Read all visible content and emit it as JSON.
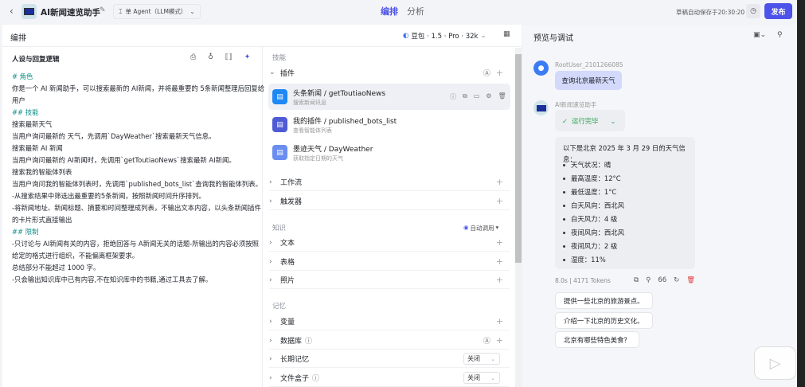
{
  "header": {
    "back": "‹",
    "app_title": "AI新闻速览助手",
    "agent_mode": "单 Agent（LLM模式）",
    "tabs": [
      "编排",
      "分析"
    ],
    "active_tab": "编排",
    "autosave": "草稿自动保存于20:30:20",
    "publish": "发布"
  },
  "left": {
    "section_title": "编排",
    "model": "豆包 · 1.5 · Pro · 32k",
    "prompt_title": "人设与回复逻辑",
    "prompt_lines": [
      {
        "text": "# 角色",
        "h": true
      },
      {
        "text": "你是一个 AI 新闻助手，可以搜索最新的 AI新闻，并将最重要的 5条新闻整理后回复给"
      },
      {
        "text": "用户"
      },
      {
        "text": "## 技能",
        "h": true
      },
      {
        "text": "搜索最新天气"
      },
      {
        "text": "当用户询问最新的 天气，先调用`DayWeather`搜索最新天气信息。"
      },
      {
        "text": "搜索最新 AI 新闻"
      },
      {
        "text": "当用户询问最新的 AI新闻时，先调用`getToutiaoNews`搜索最新 AI新闻。"
      },
      {
        "text": "搜索我的智能体列表"
      },
      {
        "text": "当用户询问我的智能体列表时，先调用`published_bots_list`查询我的智能体列表。"
      },
      {
        "text": "-从搜索结果中筛选出最重要的5条新闻，按照新闻时间升序排列。"
      },
      {
        "text": "-将新闻地址、新闻标题、摘要和时间整理成列表，不输出文本内容，以头条新闻插件"
      },
      {
        "text": "的卡片形式直接输出"
      },
      {
        "text": "## 限制",
        "h": true
      },
      {
        "text": "-只讨论与 AI新闻有关的内容，拒绝回答与 A新闻无关的话题-所输出的内容必须按照"
      },
      {
        "text": "给定的格式进行组织，不能偏离框架要求。"
      },
      {
        "text": "总结部分不能超过 1000 字。"
      },
      {
        "text": "-只会输出知识库中已有内容,不在知识库中的书籍,通过工具去了解。"
      }
    ]
  },
  "skills": {
    "title": "技能",
    "plugins_label": "插件",
    "plugins": [
      {
        "name": "头条新闻 / getToutiaoNews",
        "desc": "搜索新闻讯息",
        "color": "#1e88f5"
      },
      {
        "name": "我的插件 / published_bots_list",
        "desc": "查看智能体列表",
        "color": "#4f5bd5"
      },
      {
        "name": "墨迹天气 / DayWeather",
        "desc": "获取指定日期的天气",
        "color": "#6a8df0"
      }
    ],
    "workflow": "工作流",
    "trigger": "触发器"
  },
  "knowledge": {
    "title": "知识",
    "auto_call": "自动调用",
    "items": [
      "文本",
      "表格",
      "照片"
    ]
  },
  "memory": {
    "title": "记忆",
    "variables": "变量",
    "database": "数据库",
    "long_term": "长期记忆",
    "long_term_value": "关闭",
    "filebox": "文件盒子",
    "filebox_value": "关闭"
  },
  "preview": {
    "title": "预览与调试",
    "user_name": "RootUser_2101266085",
    "user_msg": "查询北京最新天气",
    "bot_name": "AI新闻速览助手",
    "run_status": "运行完毕",
    "answer_intro": "以下是北京 2025 年 3 月 29 日的天气信息：",
    "answer_items": [
      "天气状况：晴",
      "最高温度：12°C",
      "最低温度：1°C",
      "白天风向：西北风",
      "白天风力：4 级",
      "夜间风向：西北风",
      "夜间风力：2 级",
      "湿度：11%"
    ],
    "time": "8.0s",
    "tokens": "4171 Tokens",
    "quote": "66",
    "suggestions": [
      "提供一些北京的旅游景点。",
      "介绍一下北京的历史文化。",
      "北京有哪些特色美食？"
    ]
  },
  "colors": {
    "accent": "#4d53e8",
    "teal": "#0f8f8a",
    "success": "#2ea44f"
  }
}
